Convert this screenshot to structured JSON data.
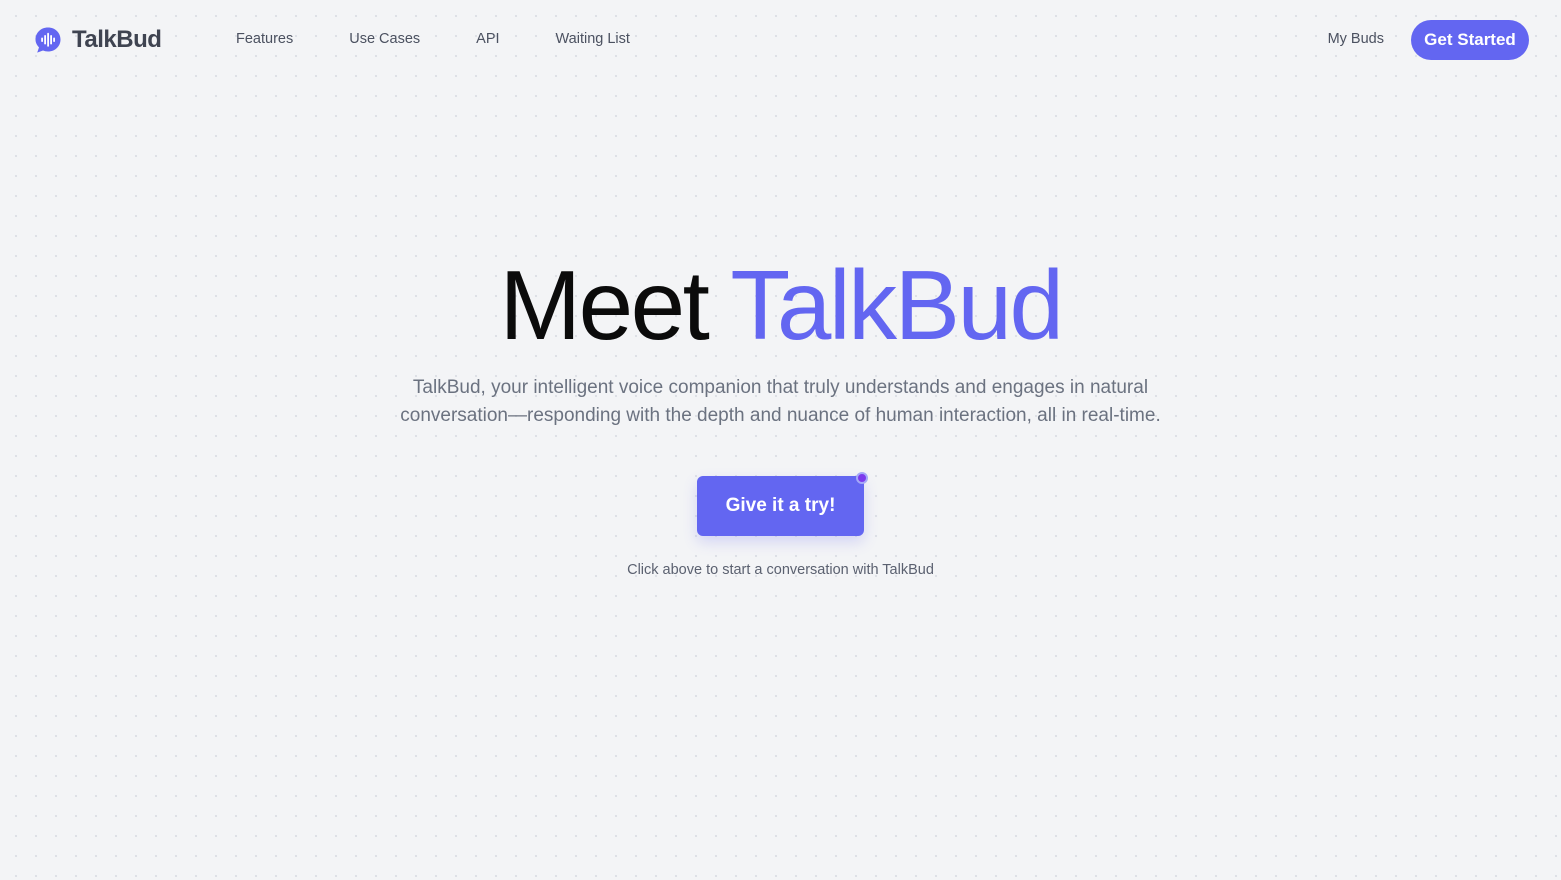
{
  "brand": {
    "name": "TalkBud",
    "icon": "voice-bubble-icon",
    "accent_color": "#6366f1"
  },
  "nav": {
    "links": [
      {
        "label": "Features"
      },
      {
        "label": "Use Cases"
      },
      {
        "label": "API"
      },
      {
        "label": "Waiting List"
      }
    ],
    "my_buds": "My Buds",
    "cta": "Get Started"
  },
  "hero": {
    "title_prefix": "Meet",
    "title_brand": "TalkBud",
    "description": "TalkBud, your intelligent voice companion that truly understands and engages in natural conversation—responding with the depth and nuance of human interaction, all in real-time.",
    "try_button": "Give it a try!",
    "hint": "Click above to start a conversation with TalkBud"
  },
  "colors": {
    "background": "#f3f4f6",
    "text_dark": "#0b0b0b",
    "text_muted": "#6b7280",
    "indicator": "#7c3aed"
  }
}
